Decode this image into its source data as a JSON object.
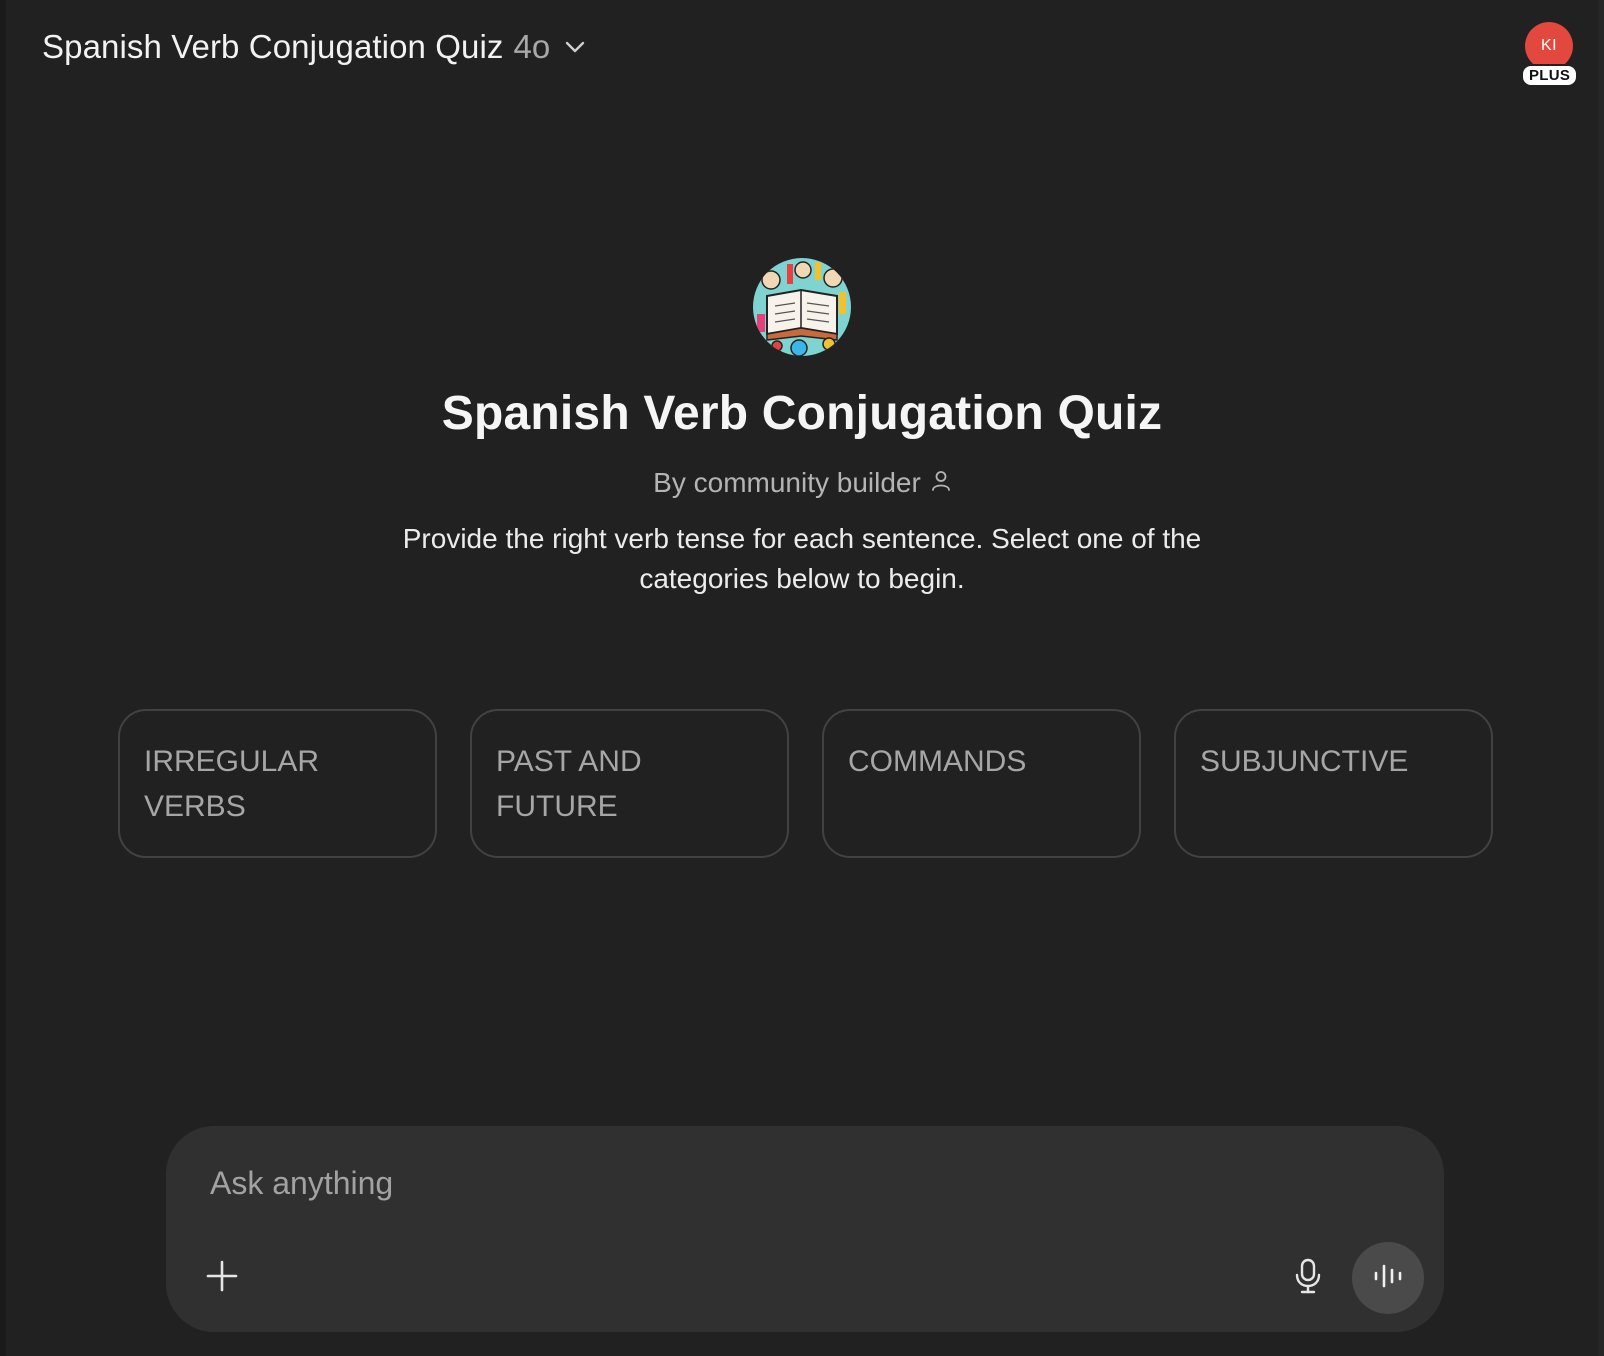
{
  "header": {
    "model_title": "Spanish Verb Conjugation Quiz",
    "model_version": "4o",
    "chevron_icon": "chevron-down-icon"
  },
  "account": {
    "initials": "KI",
    "plan_badge": "PLUS",
    "avatar_color": "#e2483d"
  },
  "gpt": {
    "logo_icon": "gpt-logo-image",
    "title": "Spanish Verb Conjugation Quiz",
    "author": "By community builder",
    "author_icon": "person-icon",
    "description": "Provide the right verb tense for each sentence. Select one of the categories below to begin."
  },
  "starters": [
    {
      "label": "IRREGULAR VERBS"
    },
    {
      "label": "PAST AND FUTURE"
    },
    {
      "label": "COMMANDS"
    },
    {
      "label": "SUBJUNCTIVE"
    }
  ],
  "composer": {
    "placeholder": "Ask anything",
    "value": "",
    "add_icon": "plus-icon",
    "mic_icon": "microphone-icon",
    "voice_icon": "voice-mode-icon"
  }
}
